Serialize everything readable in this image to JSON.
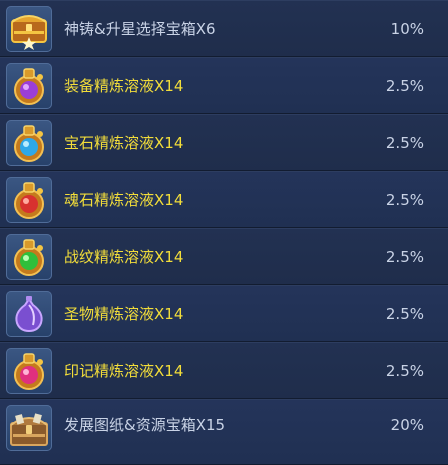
{
  "rows": [
    {
      "name": "神铸&升星选择宝箱X6",
      "percent": "10%",
      "icon": "golden-chest-icon",
      "name_color": "#c9d3e6"
    },
    {
      "name": "装备精炼溶液X14",
      "percent": "2.5%",
      "icon": "purple-potion-flask-icon",
      "name_color": "#f2dd3a"
    },
    {
      "name": "宝石精炼溶液X14",
      "percent": "2.5%",
      "icon": "blue-potion-flask-icon",
      "name_color": "#f2dd3a"
    },
    {
      "name": "魂石精炼溶液X14",
      "percent": "2.5%",
      "icon": "red-potion-flask-icon",
      "name_color": "#f2dd3a"
    },
    {
      "name": "战纹精炼溶液X14",
      "percent": "2.5%",
      "icon": "green-potion-flask-icon",
      "name_color": "#f2dd3a"
    },
    {
      "name": "圣物精炼溶液X14",
      "percent": "2.5%",
      "icon": "violet-potion-bottle-icon",
      "name_color": "#f2dd3a"
    },
    {
      "name": "印记精炼溶液X14",
      "percent": "2.5%",
      "icon": "pink-potion-flask-icon",
      "name_color": "#f2dd3a"
    },
    {
      "name": "发展图纸&资源宝箱X15",
      "percent": "20%",
      "icon": "resource-chest-icon",
      "name_color": "#c9d3e6"
    }
  ]
}
